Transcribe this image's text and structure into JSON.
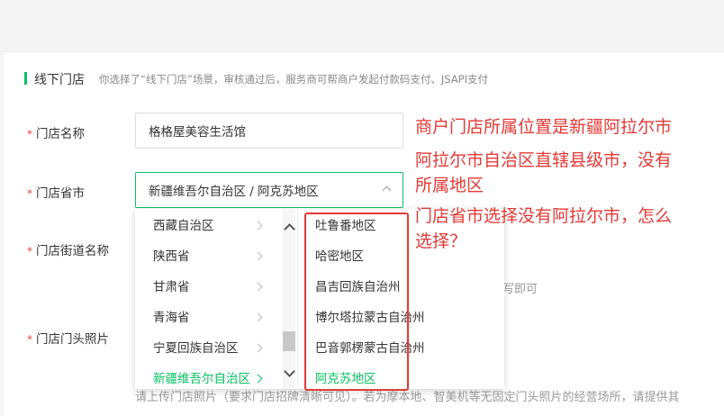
{
  "section": {
    "title": "线下门店",
    "hint": "你选择了“线下门店”场景，审核通过后，服务商可帮商户发起付款码支付、JSAPI支付"
  },
  "form": {
    "store_name": {
      "label": "门店名称",
      "value": "格格屋美容生活馆"
    },
    "store_region": {
      "label": "门店省市",
      "value": "新疆维吾尔自治区 / 阿克苏地区"
    },
    "store_street": {
      "label": "门店街道名称",
      "hint_tail": "写即可"
    },
    "store_photo": {
      "label": "门店门头照片",
      "hint_bottom": "请上传门店照片（要求门店招牌清晰可见）。若为摩本地、智美机等无固定门头照片的经营场所，请提供其"
    }
  },
  "dropdown": {
    "provinces": [
      "西藏自治区",
      "陕西省",
      "甘肃省",
      "青海省",
      "宁夏回族自治区",
      "新疆维吾尔自治区"
    ],
    "selected_province": "新疆维吾尔自治区",
    "cities": [
      "吐鲁番地区",
      "哈密地区",
      "昌吉回族自治州",
      "博尔塔拉蒙古自治州",
      "巴音郭楞蒙古自治州",
      "阿克苏地区"
    ],
    "selected_city": "阿克苏地区"
  },
  "annotation": {
    "lines": [
      "商户门店所属位置是新疆阿拉尔市",
      "阿拉尔市自治区直辖县级市，没有",
      "所属地区",
      "门店省市选择没有阿拉尔市，怎么",
      "选择？"
    ]
  },
  "colors": {
    "accent": "#07c160",
    "required": "#e64340",
    "annotation": "#e53935"
  },
  "icons": {
    "region_toggle": "chevron-up-icon",
    "province_arrow": "chevron-right-icon"
  }
}
